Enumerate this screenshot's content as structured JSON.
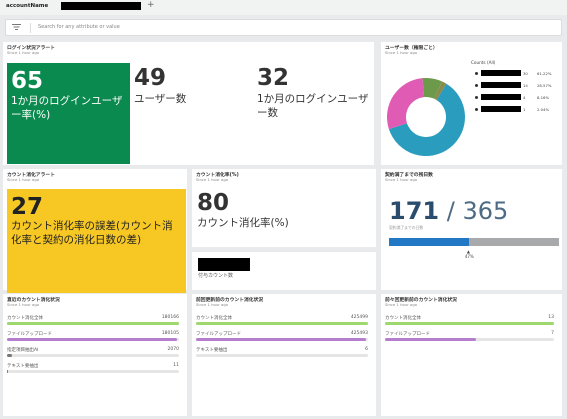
{
  "topbar": {
    "account": "accountName",
    "plus": "+"
  },
  "search": {
    "filter_icon": "filter-icon",
    "placeholder": "Search for any attribute or value"
  },
  "cards": {
    "login_alert": {
      "title": "ログイン状況アラート",
      "since": "Since 1 hour ago",
      "value": "65",
      "label": "1か月のログインユーザー率(%)"
    },
    "users": {
      "value": "49",
      "label": "ユーザー数"
    },
    "monthly_login_users": {
      "value": "32",
      "label": "1か月のログインユーザー数"
    },
    "user_count_pie": {
      "title": "ユーザー数（権限ごと）",
      "since": "Since 1 hour ago",
      "legend_title": "Counts (All)",
      "segments": [
        {
          "count": "30",
          "pct": "61.22%",
          "color": "#2a9dbe"
        },
        {
          "count": "14",
          "pct": "28.57%",
          "color": "#e05bb4"
        },
        {
          "count": "4",
          "pct": "8.16%",
          "color": "#6d9a4a"
        },
        {
          "count": "1",
          "pct": "2.04%",
          "color": "#8b8b4c"
        }
      ]
    },
    "consumption_alert": {
      "title": "カウント消化アラート",
      "since": "Since 1 hour ago",
      "value": "27",
      "label": "カウント消化率の誤差(カウント消化率と契約の消化日数の差)"
    },
    "consumption_rate": {
      "title": "カウント消化率(%)",
      "since": "Since 1 hour ago",
      "value": "80",
      "label": "カウント消化率(%)"
    },
    "paid_count": {
      "label": "付与カウント数"
    },
    "contract_days": {
      "title": "契約満了までの残日数",
      "since": "Since 1 hour ago",
      "current": "171",
      "separator": " / ",
      "total": "365",
      "sub": "契約満了までの日数",
      "progress": 0.47,
      "pct": "47%"
    },
    "recent_consumption": {
      "title": "直近のカウント消化状況",
      "since": "Since 1 hour ago",
      "rows": [
        {
          "label": "カウント消化全体",
          "value": "180166",
          "fraction": 1.0,
          "color": "#9fd86d"
        },
        {
          "label": "ファイルアップロード",
          "value": "180105",
          "fraction": 0.99,
          "color": "#b57fcd"
        },
        {
          "label": "指定項目抽出AI",
          "value": "2070",
          "fraction": 0.03,
          "color": "#777777"
        },
        {
          "label": "テキスト要抽出",
          "value": "11",
          "fraction": 0.005,
          "color": "#777777"
        }
      ]
    },
    "prev_contract_consumption": {
      "title": "前回更新前のカウント消化状況",
      "since": "Since 1 hour ago",
      "rows": [
        {
          "label": "カウント消化全体",
          "value": "425499",
          "fraction": 1.0,
          "color": "#9fd86d"
        },
        {
          "label": "ファイルアップロード",
          "value": "425493",
          "fraction": 0.99,
          "color": "#b57fcd"
        },
        {
          "label": "テキスト要抽出",
          "value": "6",
          "fraction": 0.0,
          "color": "#777777"
        }
      ]
    },
    "previous_period_consumption": {
      "title": "前々回更新前のカウント消化状況",
      "since": "Since 1 hour ago",
      "rows": [
        {
          "label": "カウント消化全体",
          "value": "13",
          "fraction": 1.0,
          "color": "#9fd86d"
        },
        {
          "label": "ファイルアップロード",
          "value": "7",
          "fraction": 0.54,
          "color": "#b57fcd"
        }
      ]
    }
  }
}
